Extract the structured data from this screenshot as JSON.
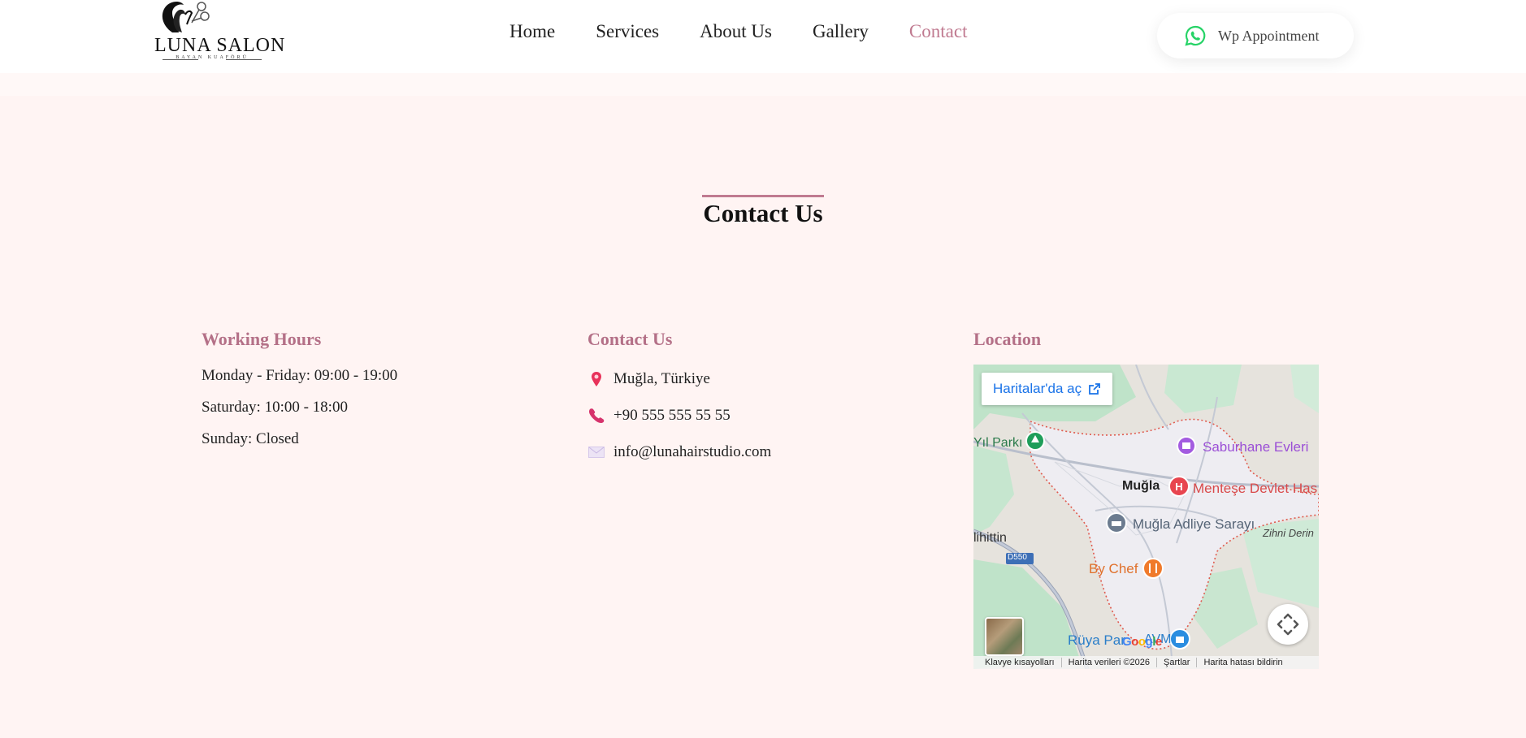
{
  "header": {
    "logo": {
      "name": "LUNA SALON",
      "subtitle": "BAYAN KUAFÖRÜ"
    },
    "nav": [
      {
        "label": "Home",
        "active": false
      },
      {
        "label": "Services",
        "active": false
      },
      {
        "label": "About Us",
        "active": false
      },
      {
        "label": "Gallery",
        "active": false
      },
      {
        "label": "Contact",
        "active": true
      }
    ],
    "cta": {
      "label": "Wp Appointment",
      "icon": "whatsapp-icon"
    }
  },
  "section": {
    "title": "Contact Us"
  },
  "working_hours": {
    "heading": "Working Hours",
    "lines": [
      "Monday - Friday: 09:00 - 19:00",
      "Saturday: 10:00 - 18:00",
      "Sunday: Closed"
    ]
  },
  "contact": {
    "heading": "Contact Us",
    "items": [
      {
        "icon": "location-pin-icon",
        "text": "Muğla, Türkiye"
      },
      {
        "icon": "phone-icon",
        "text": "+90 555 555 55 55"
      },
      {
        "icon": "envelope-icon",
        "text": "info@lunahairstudio.com"
      }
    ]
  },
  "location": {
    "heading": "Location",
    "map": {
      "open_label": "Haritalar'da aç",
      "places": {
        "park": "Yıl Parkı",
        "saburhane": "Saburhane Evleri",
        "city": "Muğla",
        "hospital": "Menteşe Devlet Has",
        "courthouse": "Muğla Adliye Sarayı",
        "zihni": "Zihni Derin",
        "muhittin": "lihittin",
        "road": "D550",
        "bychef": "By Chef",
        "ruya": "Rüya Par",
        "avm": "AVM"
      },
      "footer": [
        "Klavye kısayolları",
        "Harita verileri ©2026",
        "Şartlar",
        "Harita hatası bildirin"
      ],
      "brand": "Google"
    }
  },
  "colors": {
    "accent": "#b47087",
    "nav_active": "#c07a90",
    "background": "#fff4f3",
    "whatsapp": "#25d366"
  }
}
